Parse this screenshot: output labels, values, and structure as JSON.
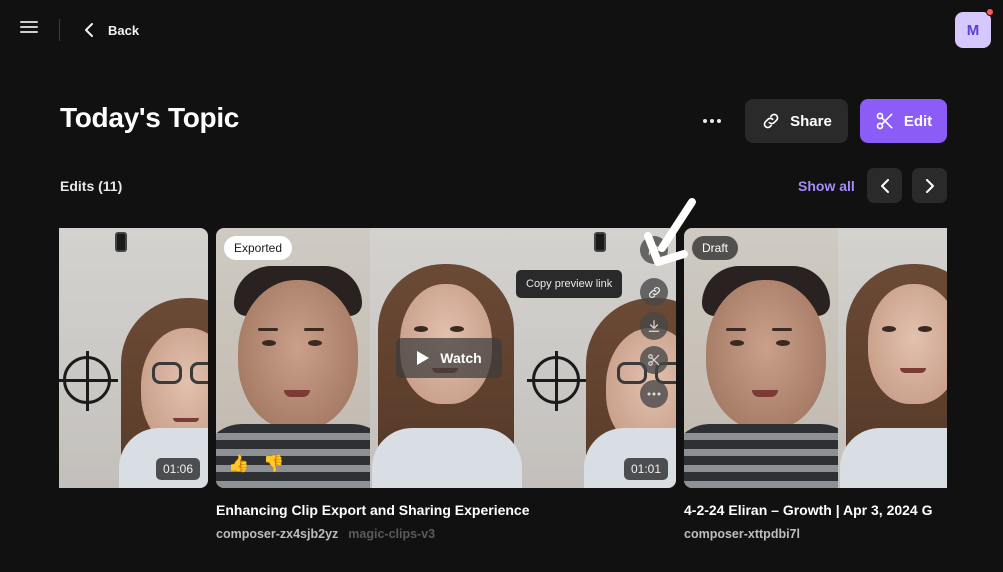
{
  "header": {
    "back_label": "Back",
    "avatar_initial": "M"
  },
  "page": {
    "title": "Today's Topic",
    "share_label": "Share",
    "edit_label": "Edit"
  },
  "section": {
    "label": "Edits (11)",
    "show_all": "Show all"
  },
  "clips": [
    {
      "duration": "01:06"
    },
    {
      "status": "Exported",
      "duration": "01:01",
      "watch_label": "Watch",
      "reaction_up": "👍",
      "reaction_down": "👎",
      "tooltip": "Copy preview link",
      "title": "Enhancing Clip Export and Sharing Experience",
      "id": "composer-zx4sjb2yz",
      "tag": "magic-clips-v3"
    },
    {
      "status": "Draft",
      "title": "4-2-24 Eliran – Growth | Apr 3, 2024 G",
      "id": "composer-xttpdbi7l"
    }
  ],
  "colors": {
    "background": "#111111",
    "accent": "#8b5cf6",
    "link": "#a78bfa",
    "button_dark": "#2a2a2a",
    "notification": "#ff5a5a"
  },
  "icons": [
    "menu-icon",
    "chevron-left-icon",
    "more-horizontal-icon",
    "link-icon",
    "scissors-icon",
    "chevron-right-icon",
    "play-icon",
    "share-arrow-icon",
    "download-icon"
  ]
}
